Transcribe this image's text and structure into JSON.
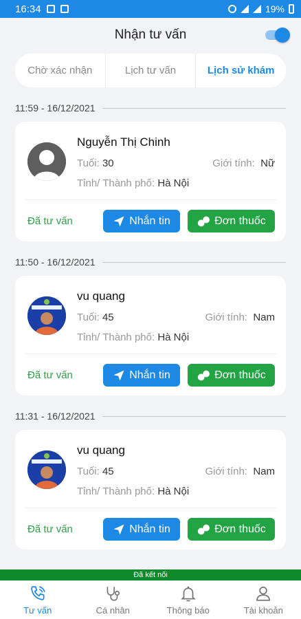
{
  "status_bar": {
    "time": "16:34",
    "battery": "19%"
  },
  "header": {
    "title": "Nhận tư vấn"
  },
  "tabs": [
    {
      "label": "Chờ xác nhận",
      "active": false
    },
    {
      "label": "Lịch tư vấn",
      "active": false
    },
    {
      "label": "Lịch sử khám",
      "active": true
    }
  ],
  "labels": {
    "age": "Tuổi:",
    "gender": "Giới tính:",
    "city": "Tỉnh/ Thành phố:",
    "message_button": "Nhắn tin",
    "prescription_button": "Đơn thuốc"
  },
  "sessions": [
    {
      "datetime": "11:59 - 16/12/2021",
      "name": "Nguyễn Thị Chinh",
      "age": "30",
      "gender": "Nữ",
      "city": "Hà Nội",
      "status": "Đã tư vấn"
    },
    {
      "datetime": "11:50 - 16/12/2021",
      "name": "vu quang",
      "age": "45",
      "gender": "Nam",
      "city": "Hà Nội",
      "status": "Đã tư vấn"
    },
    {
      "datetime": "11:31 - 16/12/2021",
      "name": "vu quang",
      "age": "45",
      "gender": "Nam",
      "city": "Hà Nội",
      "status": "Đã tư vấn"
    }
  ],
  "connection_banner": "Đã kết nối",
  "bottom_nav": [
    {
      "label": "Tư vấn",
      "icon": "phone-icon",
      "active": true
    },
    {
      "label": "Cá nhân",
      "icon": "stethoscope-icon",
      "active": false
    },
    {
      "label": "Thông báo",
      "icon": "bell-icon",
      "active": false
    },
    {
      "label": "Tài khoản",
      "icon": "user-icon",
      "active": false
    }
  ],
  "colors": {
    "primary": "#1e88e5",
    "success": "#22a445",
    "status_text": "#2f9e4a",
    "banner": "#0f8a2a"
  }
}
